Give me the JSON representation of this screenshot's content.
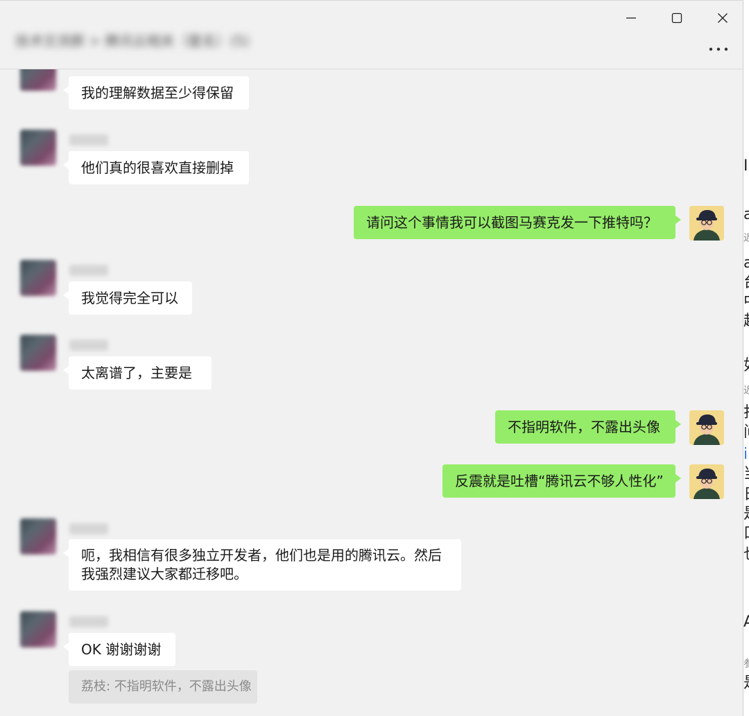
{
  "window": {
    "title": "技术交流群 > 腾讯云相关（匿名）(5)",
    "controls": {
      "minimize_icon": "minimize-icon",
      "maximize_icon": "maximize-icon",
      "close_icon": "close-icon",
      "more_icon": "more-horizontal-icon"
    }
  },
  "colors": {
    "window_bg": "#f1f1f1",
    "bubble_self": "#95ec69",
    "bubble_other": "#ffffff",
    "quote_bg": "#e3e3e3"
  },
  "messages": [
    {
      "from": "other",
      "text": "我的理解数据至少得保留"
    },
    {
      "from": "other",
      "text": "他们真的很喜欢直接删掉"
    },
    {
      "from": "self",
      "text": "请问这个事情我可以截图马赛克发一下推特吗？"
    },
    {
      "from": "other",
      "text": "我觉得完全可以"
    },
    {
      "from": "other",
      "text": " 太离谱了，主要是"
    },
    {
      "from": "self",
      "text": "不指明软件，不露出头像"
    },
    {
      "from": "self",
      "text": "反震就是吐槽“腾讯云不够人性化”"
    },
    {
      "from": "other",
      "text_line1": "呃，我相信有很多独立开发者，他们也是用的腾讯云。然后",
      "text_line2": "我强烈建议大家都迁移吧。"
    },
    {
      "from": "other",
      "text": "OK 谢谢谢谢"
    }
  ],
  "quote": {
    "text": "荔枝: 不指明软件，不露出头像"
  },
  "background_window": {
    "fragments": [
      "I",
      "a",
      "近",
      "a",
      "台",
      "中",
      "越",
      "如",
      "近",
      "打",
      "问",
      "i",
      "当",
      "日",
      "是",
      "口",
      "也",
      "A",
      "参",
      "是"
    ]
  }
}
